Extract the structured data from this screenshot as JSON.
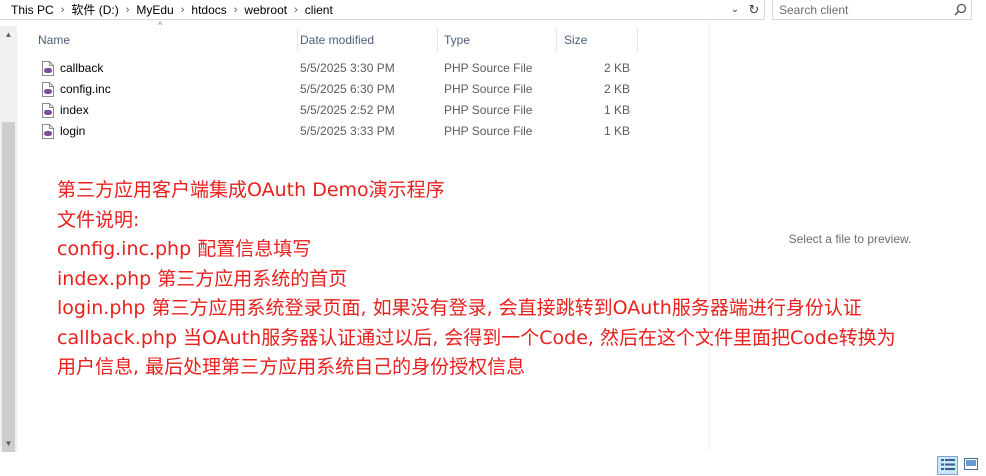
{
  "address": {
    "crumbs": [
      "This PC",
      "软件 (D:)",
      "MyEdu",
      "htdocs",
      "webroot",
      "client"
    ],
    "separator": "›"
  },
  "search": {
    "placeholder": "Search client"
  },
  "columns": {
    "name": "Name",
    "date": "Date modified",
    "type": "Type",
    "size": "Size"
  },
  "files": [
    {
      "name": "callback",
      "date": "5/5/2025 3:30 PM",
      "type": "PHP Source File",
      "size": "2 KB",
      "icon": "php-file-icon"
    },
    {
      "name": "config.inc",
      "date": "5/5/2025 6:30 PM",
      "type": "PHP Source File",
      "size": "2 KB",
      "icon": "php-file-icon"
    },
    {
      "name": "index",
      "date": "5/5/2025 2:52 PM",
      "type": "PHP Source File",
      "size": "1 KB",
      "icon": "php-file-icon"
    },
    {
      "name": "login",
      "date": "5/5/2025 3:33 PM",
      "type": "PHP Source File",
      "size": "1 KB",
      "icon": "php-file-icon"
    }
  ],
  "annotation": {
    "color": "#e8201e",
    "lines": [
      "第三方应用客户端集成OAuth Demo演示程序",
      "文件说明:",
      "config.inc.php 配置信息填写",
      "index.php 第三方应用系统的首页",
      "login.php 第三方应用系统登录页面, 如果没有登录, 会直接跳转到OAuth服务器端进行身份认证",
      "callback.php 当OAuth服务器认证通过以后, 会得到一个Code, 然后在这个文件里面把Code转换为",
      "用户信息, 最后处理第三方应用系统自己的身份授权信息"
    ]
  },
  "preview": {
    "message": "Select a file to preview."
  },
  "view_buttons": {
    "active": "details-view",
    "icons": [
      "details-view-icon",
      "large-icons-view-icon"
    ]
  }
}
